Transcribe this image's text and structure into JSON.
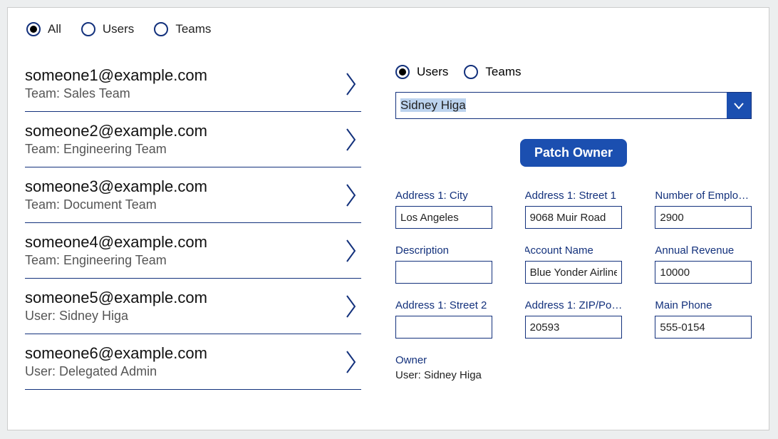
{
  "filters": {
    "all": {
      "label": "All",
      "selected": true
    },
    "users": {
      "label": "Users",
      "selected": false
    },
    "teams": {
      "label": "Teams",
      "selected": false
    }
  },
  "list": [
    {
      "primary": "someone1@example.com",
      "secondary": "Team: Sales Team"
    },
    {
      "primary": "someone2@example.com",
      "secondary": "Team: Engineering Team"
    },
    {
      "primary": "someone3@example.com",
      "secondary": "Team: Document Team"
    },
    {
      "primary": "someone4@example.com",
      "secondary": "Team: Engineering Team"
    },
    {
      "primary": "someone5@example.com",
      "secondary": "User: Sidney Higa"
    },
    {
      "primary": "someone6@example.com",
      "secondary": "User: Delegated Admin"
    }
  ],
  "detail": {
    "radios": {
      "users": {
        "label": "Users",
        "selected": true
      },
      "teams": {
        "label": "Teams",
        "selected": false
      }
    },
    "select_value": "Sidney Higa",
    "patch_button": "Patch Owner",
    "fields": {
      "city": {
        "label": "Address 1: City",
        "value": "Los Angeles",
        "required": false
      },
      "street1": {
        "label": "Address 1: Street 1",
        "value": "9068 Muir Road",
        "required": false
      },
      "employees": {
        "label": "Number of Emplo…",
        "value": "2900",
        "required": false
      },
      "description": {
        "label": "Description",
        "value": "",
        "required": false
      },
      "account": {
        "label": "Account Name",
        "value": "Blue Yonder Airlines",
        "required": true
      },
      "revenue": {
        "label": "Annual Revenue",
        "value": "10000",
        "required": false
      },
      "street2": {
        "label": "Address 1: Street 2",
        "value": "",
        "required": false
      },
      "zip": {
        "label": "Address 1: ZIP/Po…",
        "value": "20593",
        "required": false
      },
      "phone": {
        "label": "Main Phone",
        "value": "555-0154",
        "required": false
      }
    },
    "owner": {
      "label": "Owner",
      "value": "User: Sidney Higa"
    }
  }
}
